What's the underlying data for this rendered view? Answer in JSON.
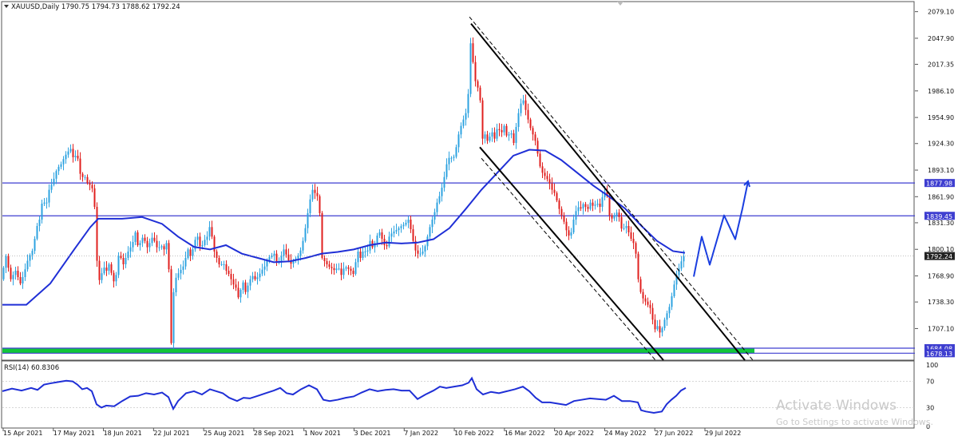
{
  "header": {
    "symbol_info": "XAUUSD,Daily  1790.75 1794.73 1788.62 1792.24",
    "indicator_label": "RSI(14) 60.8306"
  },
  "watermark": {
    "title": "Activate Windows",
    "subtitle": "Go to Settings to activate Windows."
  },
  "colors": {
    "candle_up": "#2ea3e0",
    "candle_down": "#e0201f",
    "moving_average": "#1f2fd6",
    "levels": "#3e3ed0",
    "support_zone": "#12c63a",
    "channel": "#000000",
    "projection": "#1a3ee0",
    "rsi": "#1f2fd6",
    "current_price_label_bg": "#222222"
  },
  "chart_data": {
    "type": "candlestick",
    "symbol": "XAUUSD",
    "timeframe": "Daily",
    "last_bar": {
      "open": 1790.75,
      "high": 1794.73,
      "low": 1788.62,
      "close": 1792.24
    },
    "price_axis_ticks": [
      2079.1,
      2047.9,
      2017.35,
      1986.1,
      1954.9,
      1924.3,
      1893.1,
      1861.9,
      1831.3,
      1800.1,
      1768.9,
      1738.3,
      1707.1
    ],
    "price_range": [
      1670,
      2090
    ],
    "date_axis_ticks": [
      "15 Apr 2021",
      "17 May 2021",
      "18 Jun 2021",
      "22 Jul 2021",
      "25 Aug 2021",
      "28 Sep 2021",
      "1 Nov 2021",
      "3 Dec 2021",
      "7 Jan 2022",
      "10 Feb 2022",
      "16 Mar 2022",
      "20 Apr 2022",
      "24 May 2022",
      "27 Jun 2022",
      "29 Jul 2022"
    ],
    "horizontal_levels": [
      {
        "label": "1877.98",
        "value": 1877.98
      },
      {
        "label": "1839.45",
        "value": 1839.45
      },
      {
        "label": "1684.08",
        "value": 1684.08
      },
      {
        "label": "1678.13",
        "value": 1678.13
      }
    ],
    "current_price_label": "1792.24",
    "support_zone": [
      1678.13,
      1684.08
    ],
    "ohlc_path": [
      [
        0,
        1765
      ],
      [
        6,
        1792
      ],
      [
        12,
        1765
      ],
      [
        18,
        1775
      ],
      [
        24,
        1760
      ],
      [
        28,
        1770
      ],
      [
        34,
        1790
      ],
      [
        40,
        1800
      ],
      [
        44,
        1825
      ],
      [
        48,
        1835
      ],
      [
        52,
        1860
      ],
      [
        56,
        1850
      ],
      [
        60,
        1870
      ],
      [
        65,
        1880
      ],
      [
        70,
        1895
      ],
      [
        75,
        1900
      ],
      [
        80,
        1910
      ],
      [
        84,
        1915
      ],
      [
        87,
        1918
      ],
      [
        91,
        1905
      ],
      [
        95,
        1915
      ],
      [
        98,
        1890
      ],
      [
        102,
        1885
      ],
      [
        105,
        1885
      ],
      [
        108,
        1878
      ],
      [
        112,
        1875
      ],
      [
        115,
        1870
      ],
      [
        118,
        1840
      ],
      [
        121,
        1760
      ],
      [
        125,
        1768
      ],
      [
        128,
        1780
      ],
      [
        132,
        1775
      ],
      [
        136,
        1785
      ],
      [
        140,
        1760
      ],
      [
        144,
        1770
      ],
      [
        148,
        1800
      ],
      [
        152,
        1780
      ],
      [
        156,
        1790
      ],
      [
        160,
        1800
      ],
      [
        164,
        1805
      ],
      [
        168,
        1820
      ],
      [
        172,
        1800
      ],
      [
        176,
        1815
      ],
      [
        180,
        1810
      ],
      [
        184,
        1800
      ],
      [
        188,
        1815
      ],
      [
        192,
        1810
      ],
      [
        196,
        1800
      ],
      [
        200,
        1805
      ],
      [
        204,
        1800
      ],
      [
        208,
        1810
      ],
      [
        211,
        1760
      ],
      [
        213,
        1690
      ],
      [
        215,
        1742
      ],
      [
        218,
        1765
      ],
      [
        222,
        1772
      ],
      [
        228,
        1780
      ],
      [
        234,
        1800
      ],
      [
        238,
        1790
      ],
      [
        242,
        1810
      ],
      [
        246,
        1815
      ],
      [
        250,
        1800
      ],
      [
        254,
        1810
      ],
      [
        258,
        1815
      ],
      [
        262,
        1830
      ],
      [
        266,
        1800
      ],
      [
        270,
        1790
      ],
      [
        274,
        1780
      ],
      [
        278,
        1785
      ],
      [
        282,
        1775
      ],
      [
        286,
        1770
      ],
      [
        290,
        1760
      ],
      [
        294,
        1755
      ],
      [
        298,
        1740
      ],
      [
        302,
        1765
      ],
      [
        306,
        1750
      ],
      [
        310,
        1760
      ],
      [
        314,
        1770
      ],
      [
        318,
        1765
      ],
      [
        322,
        1768
      ],
      [
        326,
        1775
      ],
      [
        330,
        1780
      ],
      [
        334,
        1790
      ],
      [
        338,
        1792
      ],
      [
        342,
        1795
      ],
      [
        346,
        1782
      ],
      [
        350,
        1790
      ],
      [
        354,
        1800
      ],
      [
        358,
        1792
      ],
      [
        362,
        1782
      ],
      [
        366,
        1787
      ],
      [
        370,
        1790
      ],
      [
        374,
        1795
      ],
      [
        378,
        1810
      ],
      [
        382,
        1830
      ],
      [
        386,
        1855
      ],
      [
        390,
        1870
      ],
      [
        394,
        1865
      ],
      [
        398,
        1860
      ],
      [
        402,
        1790
      ],
      [
        406,
        1785
      ],
      [
        410,
        1780
      ],
      [
        414,
        1778
      ],
      [
        418,
        1775
      ],
      [
        422,
        1780
      ],
      [
        426,
        1770
      ],
      [
        430,
        1780
      ],
      [
        434,
        1778
      ],
      [
        438,
        1775
      ],
      [
        442,
        1770
      ],
      [
        446,
        1800
      ],
      [
        450,
        1790
      ],
      [
        454,
        1800
      ],
      [
        458,
        1795
      ],
      [
        462,
        1810
      ],
      [
        466,
        1800
      ],
      [
        470,
        1815
      ],
      [
        474,
        1820
      ],
      [
        478,
        1810
      ],
      [
        482,
        1800
      ],
      [
        486,
        1815
      ],
      [
        490,
        1820
      ],
      [
        494,
        1822
      ],
      [
        498,
        1825
      ],
      [
        502,
        1828
      ],
      [
        506,
        1830
      ],
      [
        510,
        1835
      ],
      [
        514,
        1820
      ],
      [
        518,
        1800
      ],
      [
        522,
        1795
      ],
      [
        526,
        1795
      ],
      [
        530,
        1800
      ],
      [
        534,
        1815
      ],
      [
        538,
        1830
      ],
      [
        542,
        1840
      ],
      [
        546,
        1855
      ],
      [
        550,
        1865
      ],
      [
        554,
        1880
      ],
      [
        558,
        1900
      ],
      [
        562,
        1910
      ],
      [
        566,
        1905
      ],
      [
        570,
        1920
      ],
      [
        574,
        1940
      ],
      [
        578,
        1950
      ],
      [
        582,
        1960
      ],
      [
        586,
        1990
      ],
      [
        588,
        2042
      ],
      [
        590,
        2040
      ],
      [
        592,
        2000
      ],
      [
        596,
        1995
      ],
      [
        600,
        1975
      ],
      [
        603,
        1930
      ],
      [
        606,
        1935
      ],
      [
        610,
        1925
      ],
      [
        614,
        1940
      ],
      [
        618,
        1930
      ],
      [
        622,
        1945
      ],
      [
        626,
        1935
      ],
      [
        630,
        1945
      ],
      [
        634,
        1930
      ],
      [
        638,
        1940
      ],
      [
        642,
        1925
      ],
      [
        646,
        1950
      ],
      [
        650,
        1970
      ],
      [
        654,
        1975
      ],
      [
        658,
        1960
      ],
      [
        662,
        1945
      ],
      [
        666,
        1935
      ],
      [
        670,
        1925
      ],
      [
        674,
        1900
      ],
      [
        678,
        1890
      ],
      [
        682,
        1885
      ],
      [
        686,
        1880
      ],
      [
        690,
        1870
      ],
      [
        694,
        1865
      ],
      [
        698,
        1850
      ],
      [
        702,
        1840
      ],
      [
        706,
        1830
      ],
      [
        710,
        1815
      ],
      [
        714,
        1820
      ],
      [
        718,
        1840
      ],
      [
        722,
        1850
      ],
      [
        726,
        1848
      ],
      [
        730,
        1855
      ],
      [
        734,
        1845
      ],
      [
        738,
        1855
      ],
      [
        742,
        1850
      ],
      [
        746,
        1855
      ],
      [
        750,
        1850
      ],
      [
        754,
        1865
      ],
      [
        758,
        1870
      ],
      [
        762,
        1840
      ],
      [
        766,
        1835
      ],
      [
        770,
        1845
      ],
      [
        774,
        1838
      ],
      [
        778,
        1820
      ],
      [
        782,
        1830
      ],
      [
        786,
        1820
      ],
      [
        790,
        1810
      ],
      [
        794,
        1805
      ],
      [
        798,
        1765
      ],
      [
        802,
        1745
      ],
      [
        806,
        1740
      ],
      [
        810,
        1735
      ],
      [
        814,
        1730
      ],
      [
        818,
        1705
      ],
      [
        822,
        1710
      ],
      [
        826,
        1700
      ],
      [
        830,
        1715
      ],
      [
        834,
        1725
      ],
      [
        838,
        1735
      ],
      [
        842,
        1755
      ],
      [
        846,
        1770
      ],
      [
        850,
        1780
      ],
      [
        854,
        1792
      ]
    ],
    "moving_average_path": [
      [
        0,
        1735
      ],
      [
        30,
        1735
      ],
      [
        60,
        1760
      ],
      [
        90,
        1800
      ],
      [
        110,
        1826
      ],
      [
        120,
        1836
      ],
      [
        150,
        1836
      ],
      [
        175,
        1838
      ],
      [
        200,
        1830
      ],
      [
        220,
        1815
      ],
      [
        240,
        1803
      ],
      [
        260,
        1800
      ],
      [
        280,
        1805
      ],
      [
        300,
        1795
      ],
      [
        320,
        1790
      ],
      [
        340,
        1785
      ],
      [
        360,
        1786
      ],
      [
        380,
        1790
      ],
      [
        400,
        1795
      ],
      [
        420,
        1797
      ],
      [
        440,
        1800
      ],
      [
        460,
        1805
      ],
      [
        480,
        1808
      ],
      [
        500,
        1807
      ],
      [
        520,
        1808
      ],
      [
        540,
        1812
      ],
      [
        560,
        1825
      ],
      [
        580,
        1847
      ],
      [
        600,
        1870
      ],
      [
        620,
        1890
      ],
      [
        640,
        1910
      ],
      [
        660,
        1917
      ],
      [
        680,
        1916
      ],
      [
        700,
        1905
      ],
      [
        720,
        1890
      ],
      [
        740,
        1875
      ],
      [
        760,
        1862
      ],
      [
        780,
        1848
      ],
      [
        800,
        1828
      ],
      [
        820,
        1810
      ],
      [
        840,
        1798
      ],
      [
        855,
        1796
      ]
    ],
    "channel_lines": [
      {
        "style": "solid",
        "points": [
          [
            587,
            2065
          ],
          [
            930,
            1670
          ]
        ]
      },
      {
        "style": "solid",
        "points": [
          [
            598,
            1920
          ],
          [
            828,
            1670
          ]
        ]
      },
      {
        "style": "dashed",
        "points": [
          [
            585,
            2073
          ],
          [
            940,
            1670
          ]
        ]
      },
      {
        "style": "dashed",
        "points": [
          [
            600,
            1907
          ],
          [
            818,
            1670
          ]
        ]
      }
    ],
    "projection_path": [
      [
        866,
        1768
      ],
      [
        876,
        1815
      ],
      [
        886,
        1782
      ],
      [
        904,
        1840
      ],
      [
        918,
        1812
      ],
      [
        927,
        1848
      ],
      [
        934,
        1880
      ]
    ],
    "rsi": {
      "label": "RSI(14) 60.8306",
      "value": 60.8306,
      "axis_ticks": [
        100,
        70,
        30,
        0
      ],
      "range": [
        0,
        100
      ],
      "series": [
        [
          0,
          55
        ],
        [
          12,
          59
        ],
        [
          24,
          56
        ],
        [
          36,
          60
        ],
        [
          44,
          57
        ],
        [
          52,
          65
        ],
        [
          60,
          67
        ],
        [
          70,
          69
        ],
        [
          80,
          71
        ],
        [
          88,
          70
        ],
        [
          94,
          65
        ],
        [
          100,
          58
        ],
        [
          106,
          60
        ],
        [
          112,
          55
        ],
        [
          118,
          35
        ],
        [
          124,
          30
        ],
        [
          130,
          33
        ],
        [
          140,
          32
        ],
        [
          150,
          40
        ],
        [
          160,
          47
        ],
        [
          170,
          48
        ],
        [
          180,
          52
        ],
        [
          190,
          50
        ],
        [
          200,
          53
        ],
        [
          208,
          46
        ],
        [
          214,
          28
        ],
        [
          220,
          40
        ],
        [
          230,
          52
        ],
        [
          240,
          55
        ],
        [
          250,
          50
        ],
        [
          260,
          58
        ],
        [
          268,
          55
        ],
        [
          276,
          52
        ],
        [
          284,
          45
        ],
        [
          294,
          40
        ],
        [
          302,
          45
        ],
        [
          310,
          44
        ],
        [
          320,
          48
        ],
        [
          330,
          52
        ],
        [
          340,
          56
        ],
        [
          348,
          60
        ],
        [
          356,
          52
        ],
        [
          364,
          50
        ],
        [
          374,
          58
        ],
        [
          384,
          64
        ],
        [
          394,
          58
        ],
        [
          402,
          42
        ],
        [
          410,
          40
        ],
        [
          420,
          42
        ],
        [
          430,
          45
        ],
        [
          440,
          47
        ],
        [
          450,
          53
        ],
        [
          460,
          58
        ],
        [
          470,
          55
        ],
        [
          480,
          57
        ],
        [
          490,
          58
        ],
        [
          500,
          56
        ],
        [
          510,
          56
        ],
        [
          520,
          43
        ],
        [
          530,
          50
        ],
        [
          540,
          56
        ],
        [
          548,
          62
        ],
        [
          556,
          60
        ],
        [
          566,
          62
        ],
        [
          576,
          64
        ],
        [
          584,
          68
        ],
        [
          588,
          75
        ],
        [
          594,
          58
        ],
        [
          602,
          50
        ],
        [
          612,
          54
        ],
        [
          622,
          52
        ],
        [
          632,
          55
        ],
        [
          642,
          58
        ],
        [
          652,
          62
        ],
        [
          660,
          55
        ],
        [
          668,
          45
        ],
        [
          676,
          38
        ],
        [
          686,
          38
        ],
        [
          696,
          36
        ],
        [
          706,
          34
        ],
        [
          716,
          40
        ],
        [
          726,
          42
        ],
        [
          736,
          44
        ],
        [
          746,
          43
        ],
        [
          756,
          42
        ],
        [
          766,
          48
        ],
        [
          776,
          40
        ],
        [
          786,
          40
        ],
        [
          796,
          38
        ],
        [
          800,
          26
        ],
        [
          806,
          24
        ],
        [
          816,
          22
        ],
        [
          826,
          24
        ],
        [
          832,
          35
        ],
        [
          838,
          42
        ],
        [
          844,
          48
        ],
        [
          850,
          56
        ],
        [
          856,
          60
        ]
      ]
    }
  }
}
